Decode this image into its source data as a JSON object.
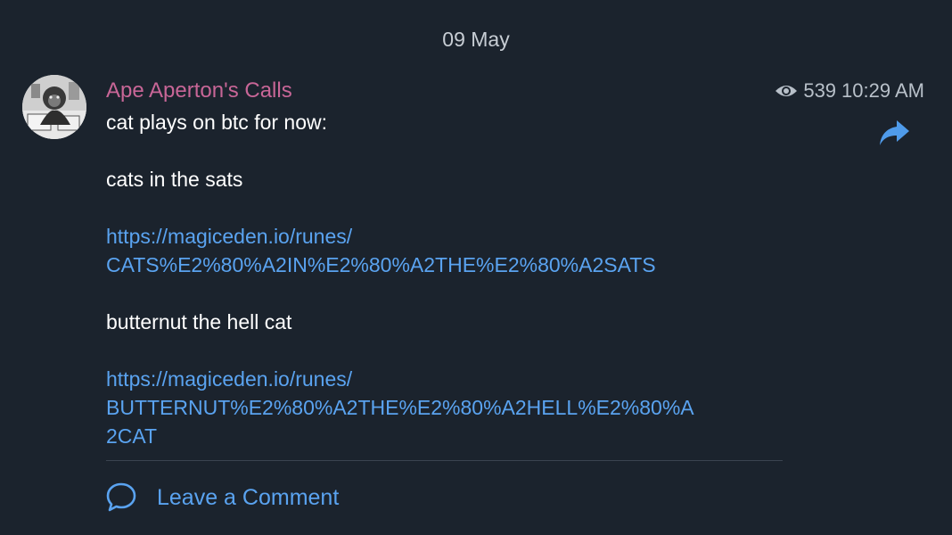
{
  "date_separator": "09 May",
  "post": {
    "channel_name": "Ape Aperton's Calls",
    "views": "539",
    "time": "10:29 AM",
    "lines": {
      "intro": "cat plays on btc for now:",
      "item1_title": "cats in the sats",
      "item1_link_line1": "https://magiceden.io/runes/",
      "item1_link_line2": "CATS%E2%80%A2IN%E2%80%A2THE%E2%80%A2SATS",
      "item2_title": "butternut the hell cat",
      "item2_link_line1": "https://magiceden.io/runes/",
      "item2_link_line2": "BUTTERNUT%E2%80%A2THE%E2%80%A2HELL%E2%80%A",
      "item2_link_line3": "2CAT"
    }
  },
  "comments": {
    "label": "Leave a Comment"
  },
  "icons": {
    "views": "eye-icon",
    "forward": "forward-icon",
    "comment": "comment-bubble-icon"
  },
  "colors": {
    "background": "#1b232d",
    "channel_name": "#c86697",
    "link": "#5aa3f0",
    "text": "#ffffff",
    "muted": "#b8c0c9"
  }
}
